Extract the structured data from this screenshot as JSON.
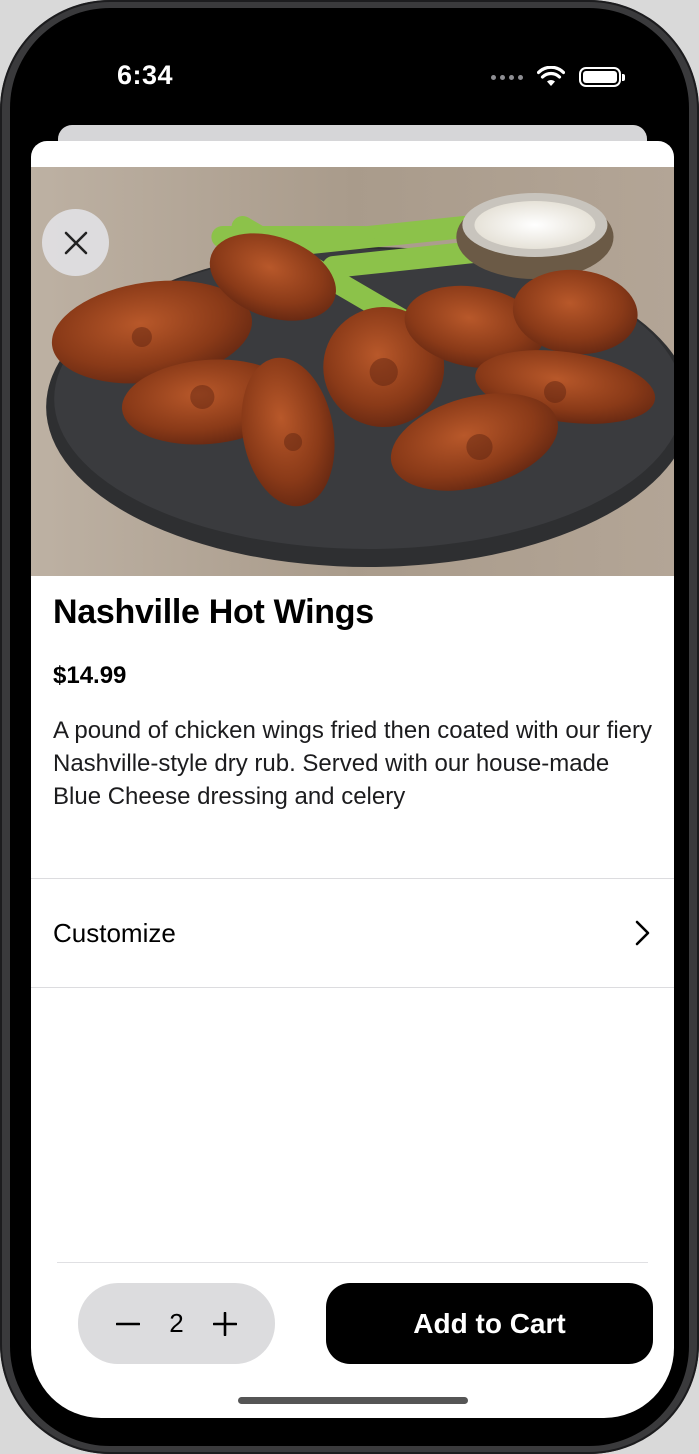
{
  "status_bar": {
    "time": "6:34",
    "icons": [
      "signal-icon",
      "wifi-icon",
      "battery-icon"
    ]
  },
  "item": {
    "image_alt": "Nashville Hot Wings photo",
    "name": "Nashville Hot Wings",
    "price": "$14.99",
    "description": "A pound of chicken wings fried then coated with our fiery Nashville-style dry rub. Served with our house-made Blue Cheese dressing and celery"
  },
  "customize": {
    "label": "Customize"
  },
  "footer": {
    "quantity": "2",
    "add_to_cart_label": "Add to Cart"
  },
  "colors": {
    "accent": "#000000",
    "stepper_bg": "#dcdcde",
    "slate": "#2e2f31",
    "wing": "#8a3a18"
  }
}
